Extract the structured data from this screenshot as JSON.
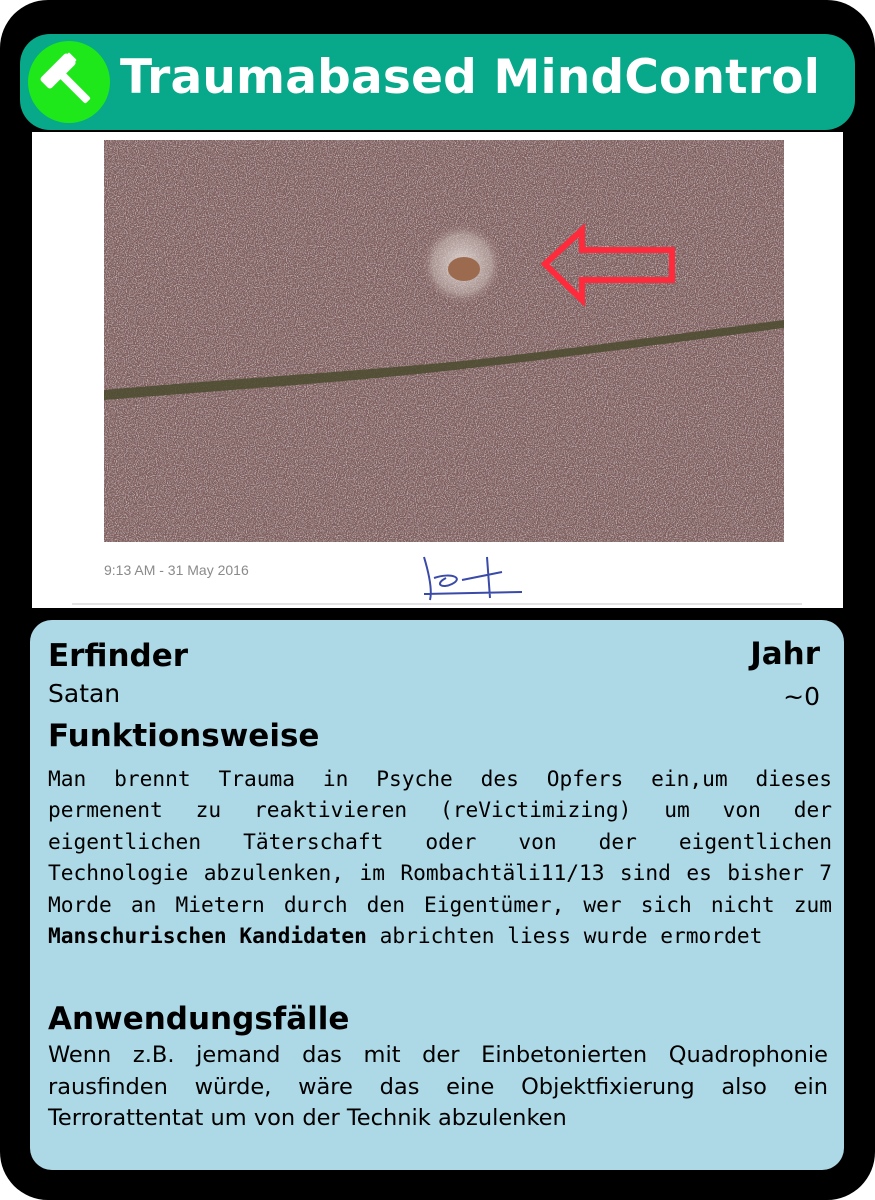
{
  "card": {
    "title": "Traumabased MindControl",
    "icon": "hammer-icon",
    "colors": {
      "frame": "#000000",
      "title_bar": "#08a88a",
      "badge": "#1ee81a",
      "panel": "#add8e6"
    }
  },
  "photo": {
    "caption": "9:13 AM - 31 May 2016",
    "arrow_color": "#ff2a3c"
  },
  "info": {
    "inventor_label": "Erfinder",
    "inventor_value": "Satan",
    "year_label": "Jahr",
    "year_value": "~0",
    "function_label": "Funktionsweise",
    "function_text_before": "Man brennt Trauma in Psyche des Opfers ein,um dieses permenent zu reaktivieren (reVictimizing) um von der eigentlichen Täterschaft oder von der eigentlichen Technologie abzulenken, im Rombachtäli11/13 sind es bisher 7 Morde an Mietern durch den Eigentümer, wer sich nicht zum ",
    "function_text_bold": "Manschurischen Kandidaten",
    "function_text_after": " abrichten liess wurde ermordet",
    "usage_label": "Anwendungsfälle",
    "usage_text": "Wenn z.B. jemand das mit der Einbetonierten Quadrophonie rausfinden würde, wäre das eine Objektfixierung also ein Terrorattentat um von der Technik abzulenken"
  }
}
